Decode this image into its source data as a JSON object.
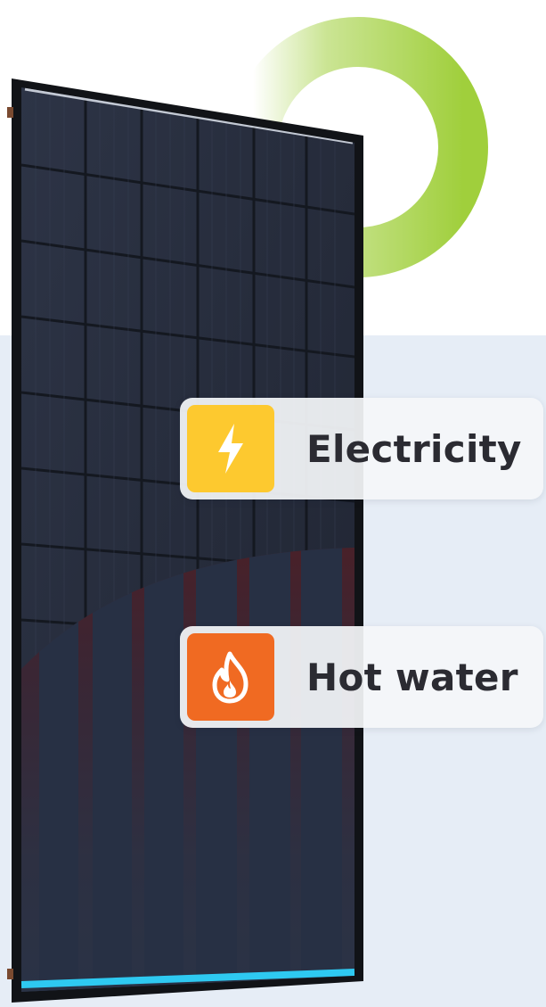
{
  "colors": {
    "accent_green": "#a0cf3c",
    "backdrop": "#e6edf6",
    "panel_frame": "#121418",
    "panel_cells": "#272d3d",
    "hot": "#ff5a1f",
    "cold": "#2ec9f1",
    "electricity_icon_bg": "#fdc92f",
    "hot_water_icon_bg": "#f06a22"
  },
  "features": [
    {
      "label": "Electricity",
      "icon": "lightning-bolt-icon"
    },
    {
      "label": "Hot water",
      "icon": "flame-icon"
    }
  ]
}
